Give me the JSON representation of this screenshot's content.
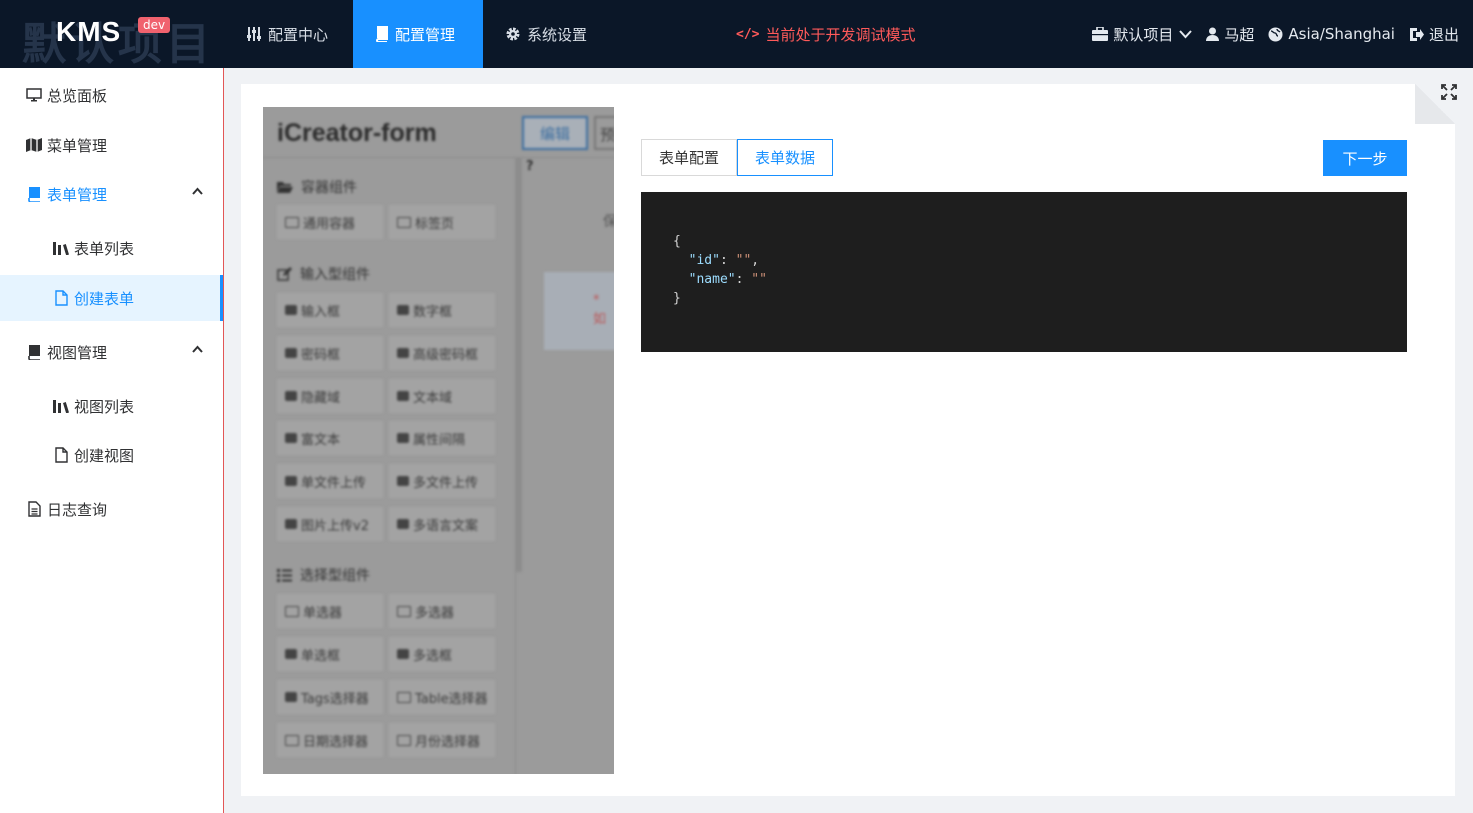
{
  "header": {
    "brand_bg_text": "默认项目",
    "brand_logo": "KMS",
    "brand_badge": "dev",
    "nav": [
      {
        "label": "配置中心",
        "icon": "sliders-icon",
        "active": false
      },
      {
        "label": "配置管理",
        "icon": "book-icon",
        "active": true
      },
      {
        "label": "系统设置",
        "icon": "gear-icon",
        "active": false
      }
    ],
    "dev_mode_icon_text": "</>",
    "dev_mode_text": "当前处于开发调试模式",
    "project_label": "默认项目",
    "user_name": "马超",
    "timezone": "Asia/Shanghai",
    "logout_label": "退出"
  },
  "sidebar": {
    "items": [
      {
        "label": "总览面板",
        "icon": "monitor-icon"
      },
      {
        "label": "菜单管理",
        "icon": "map-icon"
      },
      {
        "label": "表单管理",
        "icon": "book-icon",
        "expanded": true
      },
      {
        "label": "表单列表",
        "icon": "library-icon"
      },
      {
        "label": "创建表单",
        "icon": "file-icon",
        "selected": true
      },
      {
        "label": "视图管理",
        "icon": "book-icon",
        "expanded": true
      },
      {
        "label": "视图列表",
        "icon": "library-icon"
      },
      {
        "label": "创建视图",
        "icon": "file-icon"
      },
      {
        "label": "日志查询",
        "icon": "file-text-icon"
      }
    ]
  },
  "preview": {
    "title": "iCreator-form",
    "edit_label": "编辑",
    "edit2_label": "预",
    "help_mark": "?",
    "right_text": "保",
    "right_dot_text": "* 如",
    "categories": [
      {
        "label": "容器组件",
        "buttons": [
          "通用容器",
          "标签页"
        ]
      },
      {
        "label": "输入型组件",
        "buttons": [
          "输入框",
          "数字框",
          "密码框",
          "高级密码框",
          "隐藏域",
          "文本域",
          "富文本",
          "属性间隔",
          "单文件上传",
          "多文件上传",
          "图片上传v2",
          "多语言文案"
        ]
      },
      {
        "label": "选择型组件",
        "buttons": [
          "单选器",
          "多选器",
          "单选框",
          "多选框",
          "Tags选择器",
          "Table选择器",
          "日期选择器",
          "月份选择器"
        ]
      }
    ]
  },
  "tabs": [
    {
      "label": "表单配置",
      "active": false
    },
    {
      "label": "表单数据",
      "active": true
    }
  ],
  "next_button": "下一步",
  "json_preview": {
    "open": "{",
    "key_id": "\"id\"",
    "val_id": "\"\"",
    "key_name": "\"name\"",
    "val_name": "\"\"",
    "close": "}"
  }
}
